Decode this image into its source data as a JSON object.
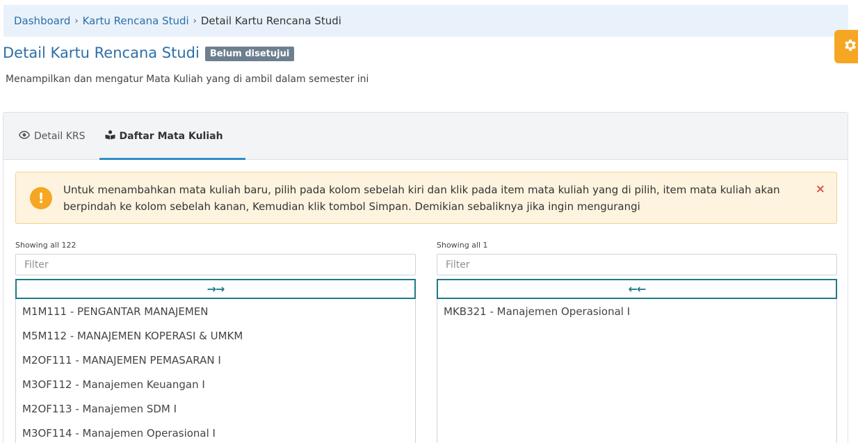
{
  "breadcrumb": {
    "items": [
      "Dashboard",
      "Kartu Rencana Studi"
    ],
    "current": "Detail Kartu Rencana Studi",
    "separator": "›"
  },
  "page": {
    "title": "Detail Kartu Rencana Studi",
    "status_badge": "Belum disetujui",
    "subtitle": "Menampilkan dan mengatur Mata Kuliah yang di ambil dalam semester ini"
  },
  "tabs": [
    {
      "label": "Detail KRS",
      "icon": "eye-icon"
    },
    {
      "label": "Daftar Mata Kuliah",
      "icon": "book-reader-icon",
      "active": true
    }
  ],
  "alert": {
    "icon": "exclamation-circle-icon",
    "text": "Untuk menambahkan mata kuliah baru, pilih pada kolom sebelah kiri dan klik pada item mata kuliah yang di pilih, item mata kuliah akan berpindah ke kolom sebelah kanan, Kemudian klik tombol Simpan. Demikian sebaliknya jika ingin mengurangi",
    "close": "×"
  },
  "dual_list": {
    "left": {
      "showing": "Showing all 122",
      "filter_placeholder": "Filter",
      "move_label": "→→",
      "items": [
        "M1M111 - PENGANTAR MANAJEMEN",
        "M5M112 - MANAJEMEN KOPERASI & UMKM",
        "M2OF111 - MANAJEMEN PEMASARAN I",
        "M3OF112 - Manajemen Keuangan I",
        "M2OF113 - Manajemen SDM I",
        "M3OF114 - Manajemen Operasional I"
      ]
    },
    "right": {
      "showing": "Showing all 1",
      "filter_placeholder": "Filter",
      "move_label": "←←",
      "items": [
        "MKB321 - Manajemen Operasional I"
      ]
    }
  },
  "colors": {
    "accent": "#2d6fa8",
    "warning": "#f5a623",
    "teal": "#1f7a84",
    "badge": "#6c7f8f"
  }
}
